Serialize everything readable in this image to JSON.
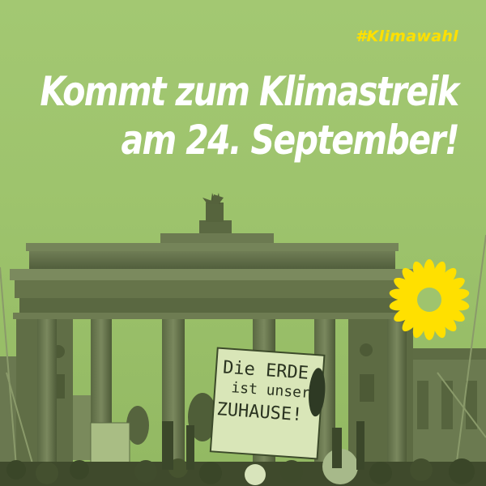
{
  "hashtag": "#Klimawahl",
  "headline": {
    "line1": "Kommt zum Klimastreik",
    "line2": "am 24. September!"
  },
  "sign": {
    "line1": "Die ERDE",
    "line2": "ist unser",
    "line3": "ZUHAUSE!"
  },
  "colors": {
    "background": "#9fc46d",
    "headline": "#ffffff",
    "hashtag": "#ffe000",
    "sunflower": "#ffe000",
    "gate_tint": "#5f6e46"
  },
  "icons": [
    "sunflower-logo-icon"
  ]
}
